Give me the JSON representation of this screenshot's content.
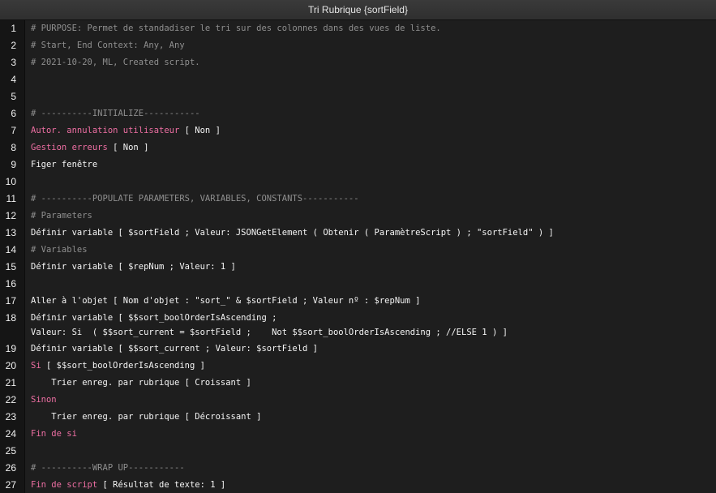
{
  "window": {
    "title": "Tri Rubrique {sortField}"
  },
  "colors": {
    "comment": "#8f8f8f",
    "keyword": "#ee6fa3",
    "step": "#f5f5f5",
    "background": "#1e1e1e"
  },
  "lines": [
    {
      "num": "1",
      "text": "# PURPOSE: Permet de standadiser le tri sur des colonnes dans des vues de liste.",
      "kind": "comment"
    },
    {
      "num": "2",
      "text": "# Start, End Context: Any, Any",
      "kind": "comment"
    },
    {
      "num": "3",
      "text": "# 2021-10-20, ML, Created script.",
      "kind": "comment"
    },
    {
      "num": "4",
      "text": "",
      "kind": "blank"
    },
    {
      "num": "5",
      "text": "",
      "kind": "blank"
    },
    {
      "num": "6",
      "text": "# ----------INITIALIZE-----------",
      "kind": "comment"
    },
    {
      "num": "7",
      "keyword": "Autor. annulation utilisateur",
      "params": " [ Non ]",
      "kind": "kw"
    },
    {
      "num": "8",
      "keyword": "Gestion erreurs",
      "params": " [ Non ]",
      "kind": "kw"
    },
    {
      "num": "9",
      "text": "Figer fenêtre",
      "kind": "step"
    },
    {
      "num": "10",
      "text": "",
      "kind": "blank"
    },
    {
      "num": "11",
      "text": "# ----------POPULATE PARAMETERS, VARIABLES, CONSTANTS-----------",
      "kind": "comment"
    },
    {
      "num": "12",
      "text": "# Parameters",
      "kind": "comment"
    },
    {
      "num": "13",
      "text": "Définir variable [ $sortField ; Valeur: JSONGetElement ( Obtenir ( ParamètreScript ) ; \"sortField\" ) ]",
      "kind": "step"
    },
    {
      "num": "14",
      "text": "# Variables",
      "kind": "comment"
    },
    {
      "num": "15",
      "text": "Définir variable [ $repNum ; Valeur: 1 ]",
      "kind": "step"
    },
    {
      "num": "16",
      "text": "",
      "kind": "blank"
    },
    {
      "num": "17",
      "text": "Aller à l'objet [ Nom d'objet : \"sort_\" & $sortField ; Valeur nº : $repNum ]",
      "kind": "step"
    },
    {
      "num": "18",
      "text": "Définir variable [ $$sort_boolOrderIsAscending ;\nValeur: Si  ( $$sort_current = $sortField ;    Not $$sort_boolOrderIsAscending ; //ELSE 1 ) ]",
      "kind": "step",
      "double": true
    },
    {
      "num": "19",
      "text": "Définir variable [ $$sort_current ; Valeur: $sortField ]",
      "kind": "step"
    },
    {
      "num": "20",
      "keyword": "Si",
      "params": " [ $$sort_boolOrderIsAscending ]",
      "kind": "kw"
    },
    {
      "num": "21",
      "text": "    Trier enreg. par rubrique [ Croissant ]",
      "kind": "step"
    },
    {
      "num": "22",
      "keyword": "Sinon",
      "params": "",
      "kind": "kw"
    },
    {
      "num": "23",
      "text": "    Trier enreg. par rubrique [ Décroissant ]",
      "kind": "step"
    },
    {
      "num": "24",
      "keyword": "Fin de si",
      "params": "",
      "kind": "kw"
    },
    {
      "num": "25",
      "text": "",
      "kind": "blank"
    },
    {
      "num": "26",
      "text": "# ----------WRAP UP-----------",
      "kind": "comment"
    },
    {
      "num": "27",
      "keyword": "Fin de script",
      "params": " [ Résultat de texte: 1 ]",
      "kind": "kw"
    }
  ]
}
